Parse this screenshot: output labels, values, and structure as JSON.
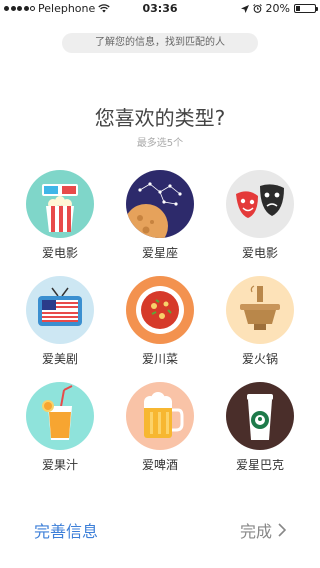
{
  "status_bar": {
    "carrier": "Pelephone",
    "time": "03:36",
    "battery_percent": "20%",
    "battery_level": 0.2,
    "signal_dots": 4
  },
  "hint": "了解您的信息，找到匹配的人",
  "title": "您喜欢的类型?",
  "subtitle": "最多选5个",
  "categories": [
    {
      "label": "爱电影",
      "icon": "3d-glasses-popcorn-icon",
      "color": "#7fd6c9"
    },
    {
      "label": "爱星座",
      "icon": "constellation-icon",
      "color": "#2d2a6b"
    },
    {
      "label": "爱电影",
      "icon": "theater-masks-icon",
      "color": "#e8e8e8"
    },
    {
      "label": "爱美剧",
      "icon": "tv-flag-icon",
      "color": "#cde7f3"
    },
    {
      "label": "爱川菜",
      "icon": "spicy-dish-icon",
      "color": "#f3924f"
    },
    {
      "label": "爱火锅",
      "icon": "hotpot-icon",
      "color": "#fde2b8"
    },
    {
      "label": "爱果汁",
      "icon": "juice-icon",
      "color": "#8fe3db"
    },
    {
      "label": "爱啤酒",
      "icon": "beer-mug-icon",
      "color": "#f9c3a7"
    },
    {
      "label": "爱星巴克",
      "icon": "starbucks-cup-icon",
      "color": "#4a2e2a"
    }
  ],
  "footer": {
    "complete_info": "完善信息",
    "done": "完成"
  }
}
